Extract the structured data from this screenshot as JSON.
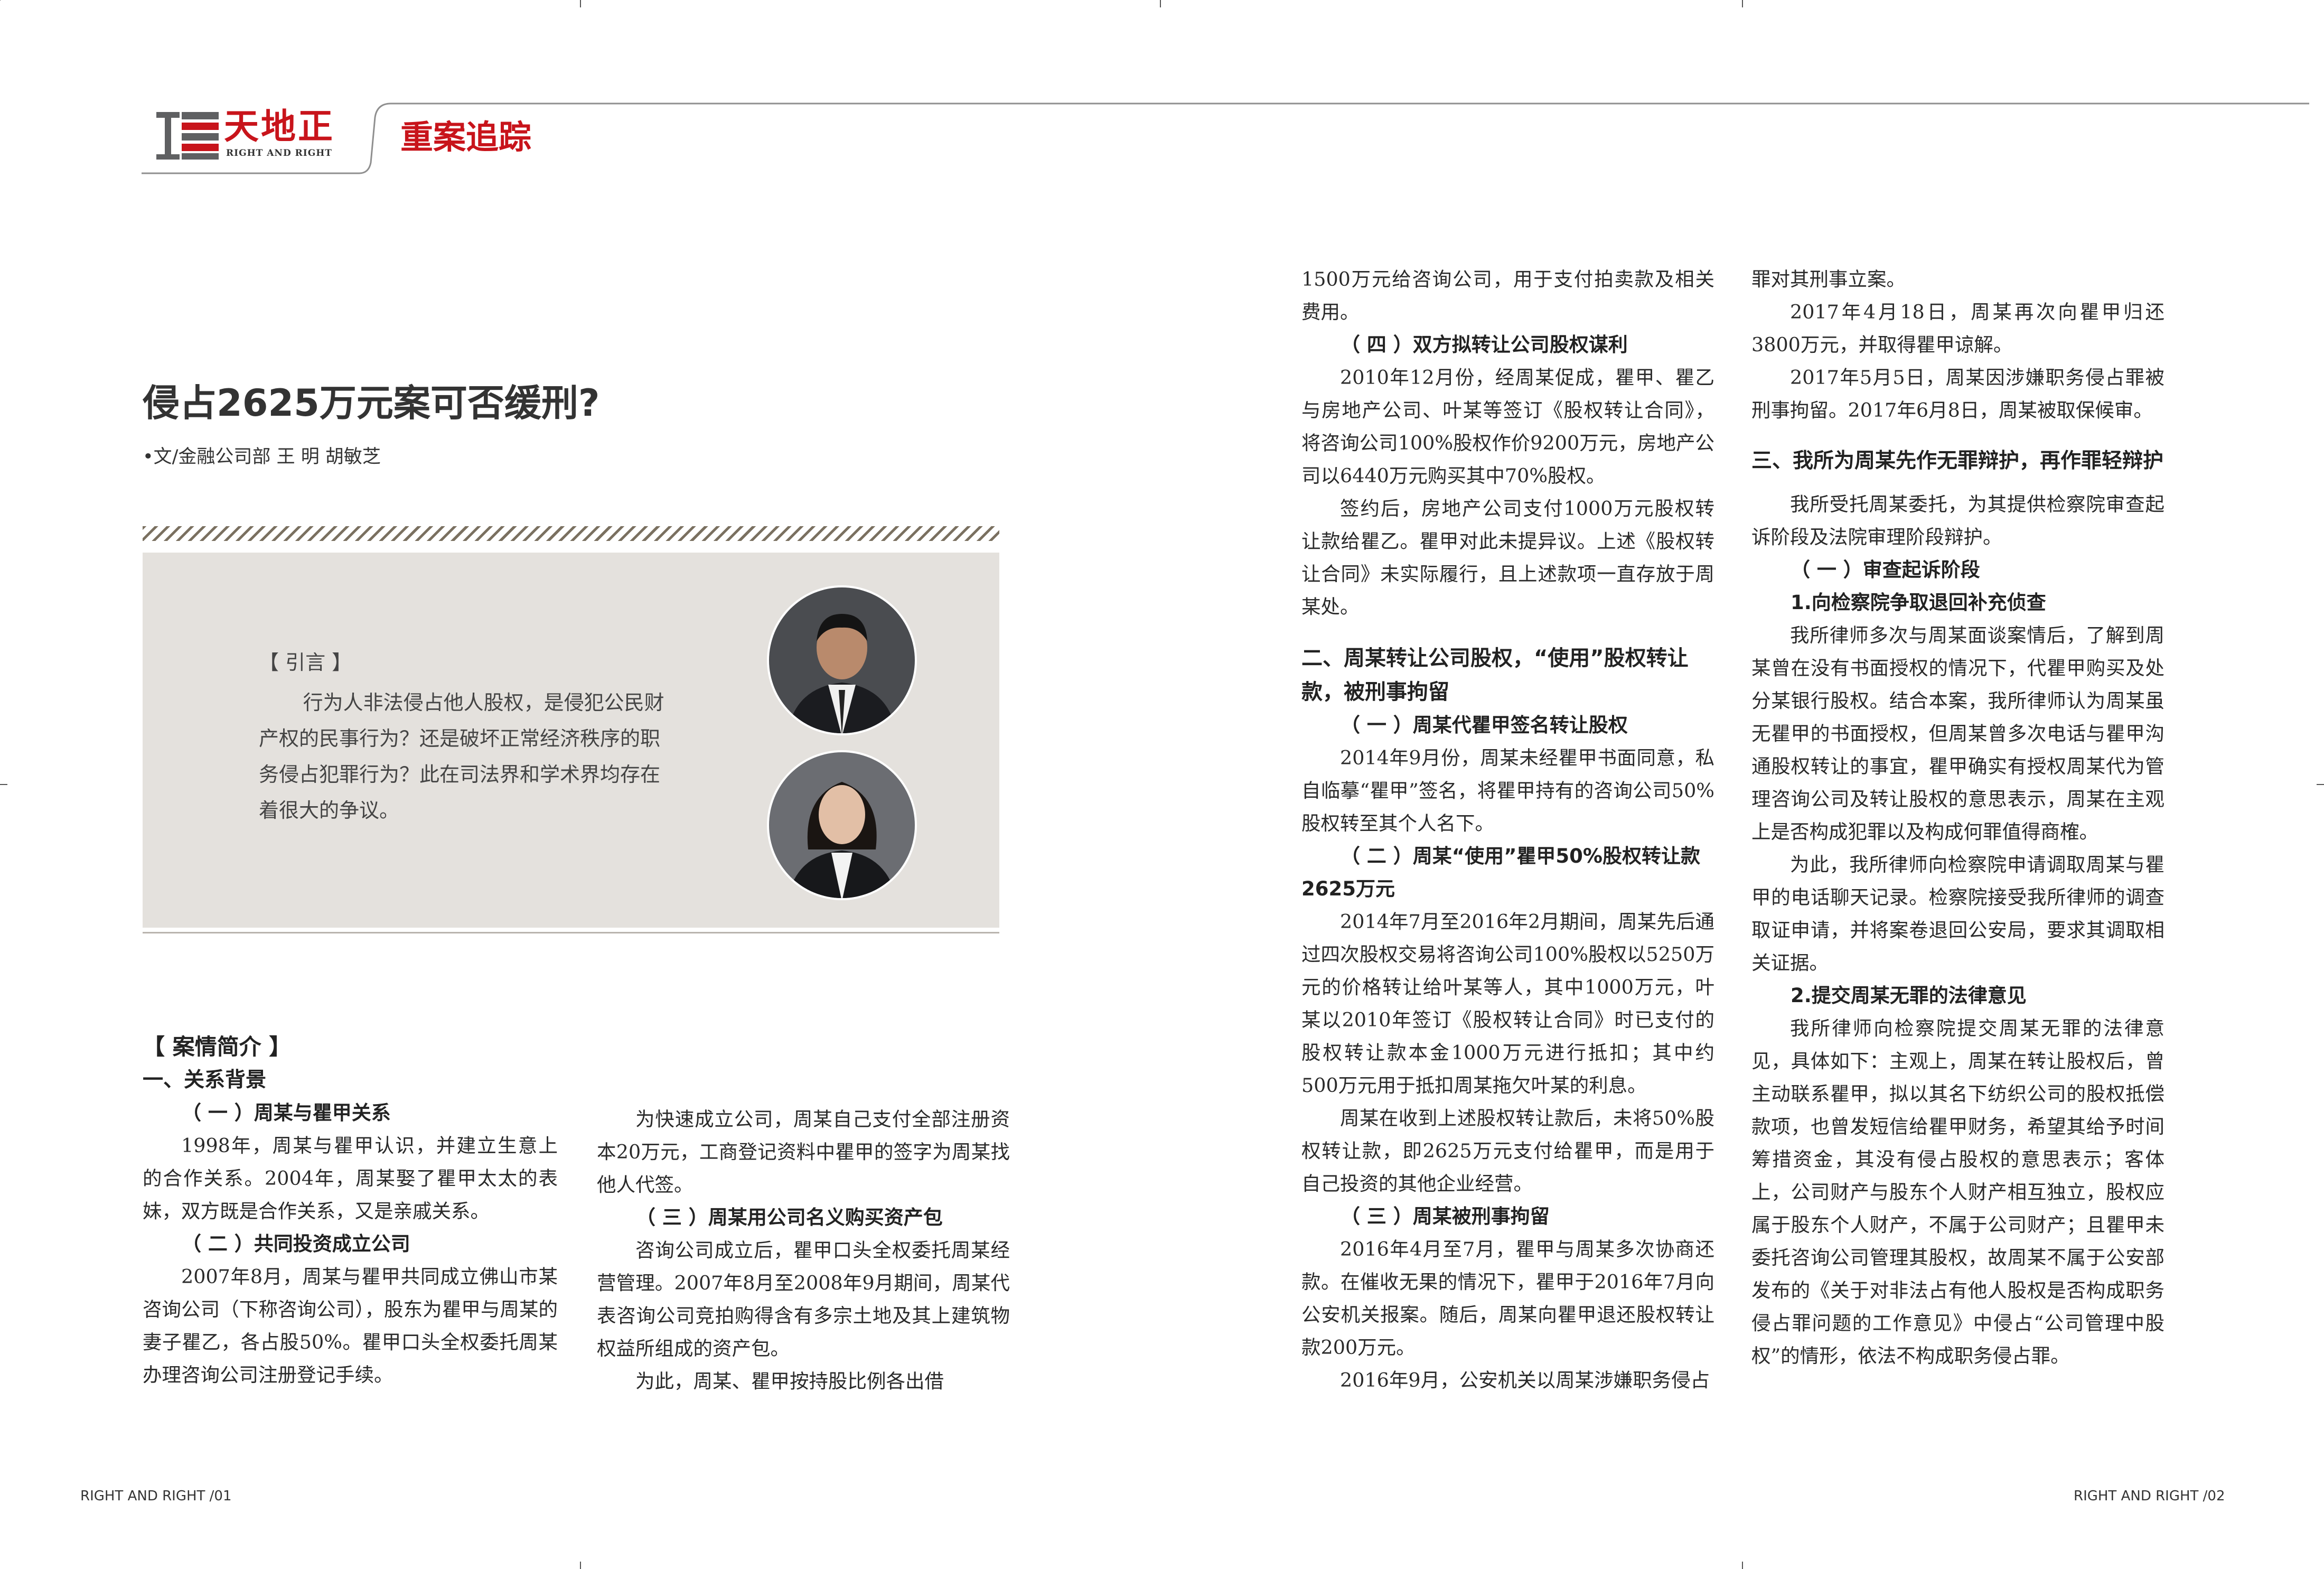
{
  "header": {
    "logo_cn": "天地正",
    "logo_en": "RIGHT AND RIGHT",
    "section": "重案追踪"
  },
  "article": {
    "title": "侵占2625万元案可否缓刑?",
    "byline": "•文/金融公司部 王 明 胡敏芝"
  },
  "intro": {
    "heading": "【 引言 】",
    "text": "行为人非法侵占他人股权，是侵犯公民财产权的民事行为？还是破坏正常经济秩序的职务侵占犯罪行为？此在司法界和学术界均存在着很大的争议。"
  },
  "col1": {
    "section_title": "【 案情简介 】",
    "h1": "一、关系背景",
    "s1": "（ 一 ）周某与瞿甲关系",
    "p1": "1998年，周某与瞿甲认识，并建立生意上的合作关系。2004年，周某娶了瞿甲太太的表妹，双方既是合作关系，又是亲戚关系。",
    "s2": "（ 二 ）共同投资成立公司",
    "p2": "2007年8月，周某与瞿甲共同成立佛山市某咨询公司（下称咨询公司），股东为瞿甲与周某的妻子瞿乙，各占股50%。瞿甲口头全权委托周某办理咨询公司注册登记手续。"
  },
  "col2": {
    "p1": "为快速成立公司，周某自己支付全部注册资本20万元，工商登记资料中瞿甲的签字为周某找他人代签。",
    "s1": "（ 三 ）周某用公司名义购买资产包",
    "p2": "咨询公司成立后，瞿甲口头全权委托周某经营管理。2007年8月至2008年9月期间，周某代表咨询公司竞拍购得含有多宗土地及其上建筑物权益所组成的资产包。",
    "p3": "为此，周某、瞿甲按持股比例各出借"
  },
  "col3": {
    "p0": "1500万元给咨询公司，用于支付拍卖款及相关费用。",
    "s1": "（ 四 ）双方拟转让公司股权谋利",
    "p1": "2010年12月份，经周某促成，瞿甲、瞿乙与房地产公司、叶某等签订《股权转让合同》，将咨询公司100%股权作价9200万元，房地产公司以6440万元购买其中70%股权。",
    "p2": "签约后，房地产公司支付1000万元股权转让款给瞿乙。瞿甲对此未提异议。上述《股权转让合同》未实际履行，且上述款项一直存放于周某处。",
    "h2": "二、周某转让公司股权，“使用”股权转让款，被刑事拘留",
    "s2": "（ 一 ）周某代瞿甲签名转让股权",
    "p3": "2014年9月份，周某未经瞿甲书面同意，私自临摹“瞿甲”签名，将瞿甲持有的咨询公司50%股权转至其个人名下。",
    "s3": "（ 二 ）周某“使用”瞿甲50%股权转让款2625万元",
    "p4": "2014年7月至2016年2月期间，周某先后通过四次股权交易将咨询公司100%股权以5250万元的价格转让给叶某等人，其中1000万元，叶某以2010年签订《股权转让合同》时已支付的股权转让款本金1000万元进行抵扣；其中约500万元用于抵扣周某拖欠叶某的利息。",
    "p5": "周某在收到上述股权转让款后，未将50%股权转让款，即2625万元支付给瞿甲，而是用于自己投资的其他企业经营。",
    "s4": "（ 三 ）周某被刑事拘留",
    "p6": "2016年4月至7月，瞿甲与周某多次协商还款。在催收无果的情况下，瞿甲于2016年7月向公安机关报案。随后，周某向瞿甲退还股权转让款200万元。",
    "p7": "2016年9月，公安机关以周某涉嫌职务侵占"
  },
  "col4": {
    "p0": "罪对其刑事立案。",
    "p1": "2017年4月18日，周某再次向瞿甲归还3800万元，并取得瞿甲谅解。",
    "p2": "2017年5月5日，周某因涉嫌职务侵占罪被刑事拘留。2017年6月8日，周某被取保候审。",
    "h3": "三、我所为周某先作无罪辩护，再作罪轻辩护",
    "p3": "我所受托周某委托，为其提供检察院审查起诉阶段及法院审理阶段辩护。",
    "s1": "（ 一 ）审查起诉阶段",
    "s2": "1.向检察院争取退回补充侦查",
    "p4": "我所律师多次与周某面谈案情后，了解到周某曾在没有书面授权的情况下，代瞿甲购买及处分某银行股权。结合本案，我所律师认为周某虽无瞿甲的书面授权，但周某曾多次电话与瞿甲沟通股权转让的事宜，瞿甲确实有授权周某代为管理咨询公司及转让股权的意思表示，周某在主观上是否构成犯罪以及构成何罪值得商榷。",
    "p5": "为此，我所律师向检察院申请调取周某与瞿甲的电话聊天记录。检察院接受我所律师的调查取证申请，并将案卷退回公安局，要求其调取相关证据。",
    "s3": "2.提交周某无罪的法律意见",
    "p6": "我所律师向检察院提交周某无罪的法律意见，具体如下：主观上，周某在转让股权后，曾主动联系瞿甲，拟以其名下纺织公司的股权抵偿款项，也曾发短信给瞿甲财务，希望其给予时间筹措资金，其没有侵占股权的意思表示；客体上，公司财产与股东个人财产相互独立，股权应属于股东个人财产，不属于公司财产；且瞿甲未委托咨询公司管理其股权，故周某不属于公安部发布的《关于对非法占有他人股权是否构成职务侵占罪问题的工作意见》中侵占“公司管理中股权”的情形，依法不构成职务侵占罪。"
  },
  "footer": {
    "left": "RIGHT AND RIGHT /01",
    "right": "RIGHT AND RIGHT /02"
  },
  "colors": {
    "brand_red": "#c8141b",
    "logo_gray": "#5f6062",
    "intro_bg": "#e4e1dd"
  }
}
